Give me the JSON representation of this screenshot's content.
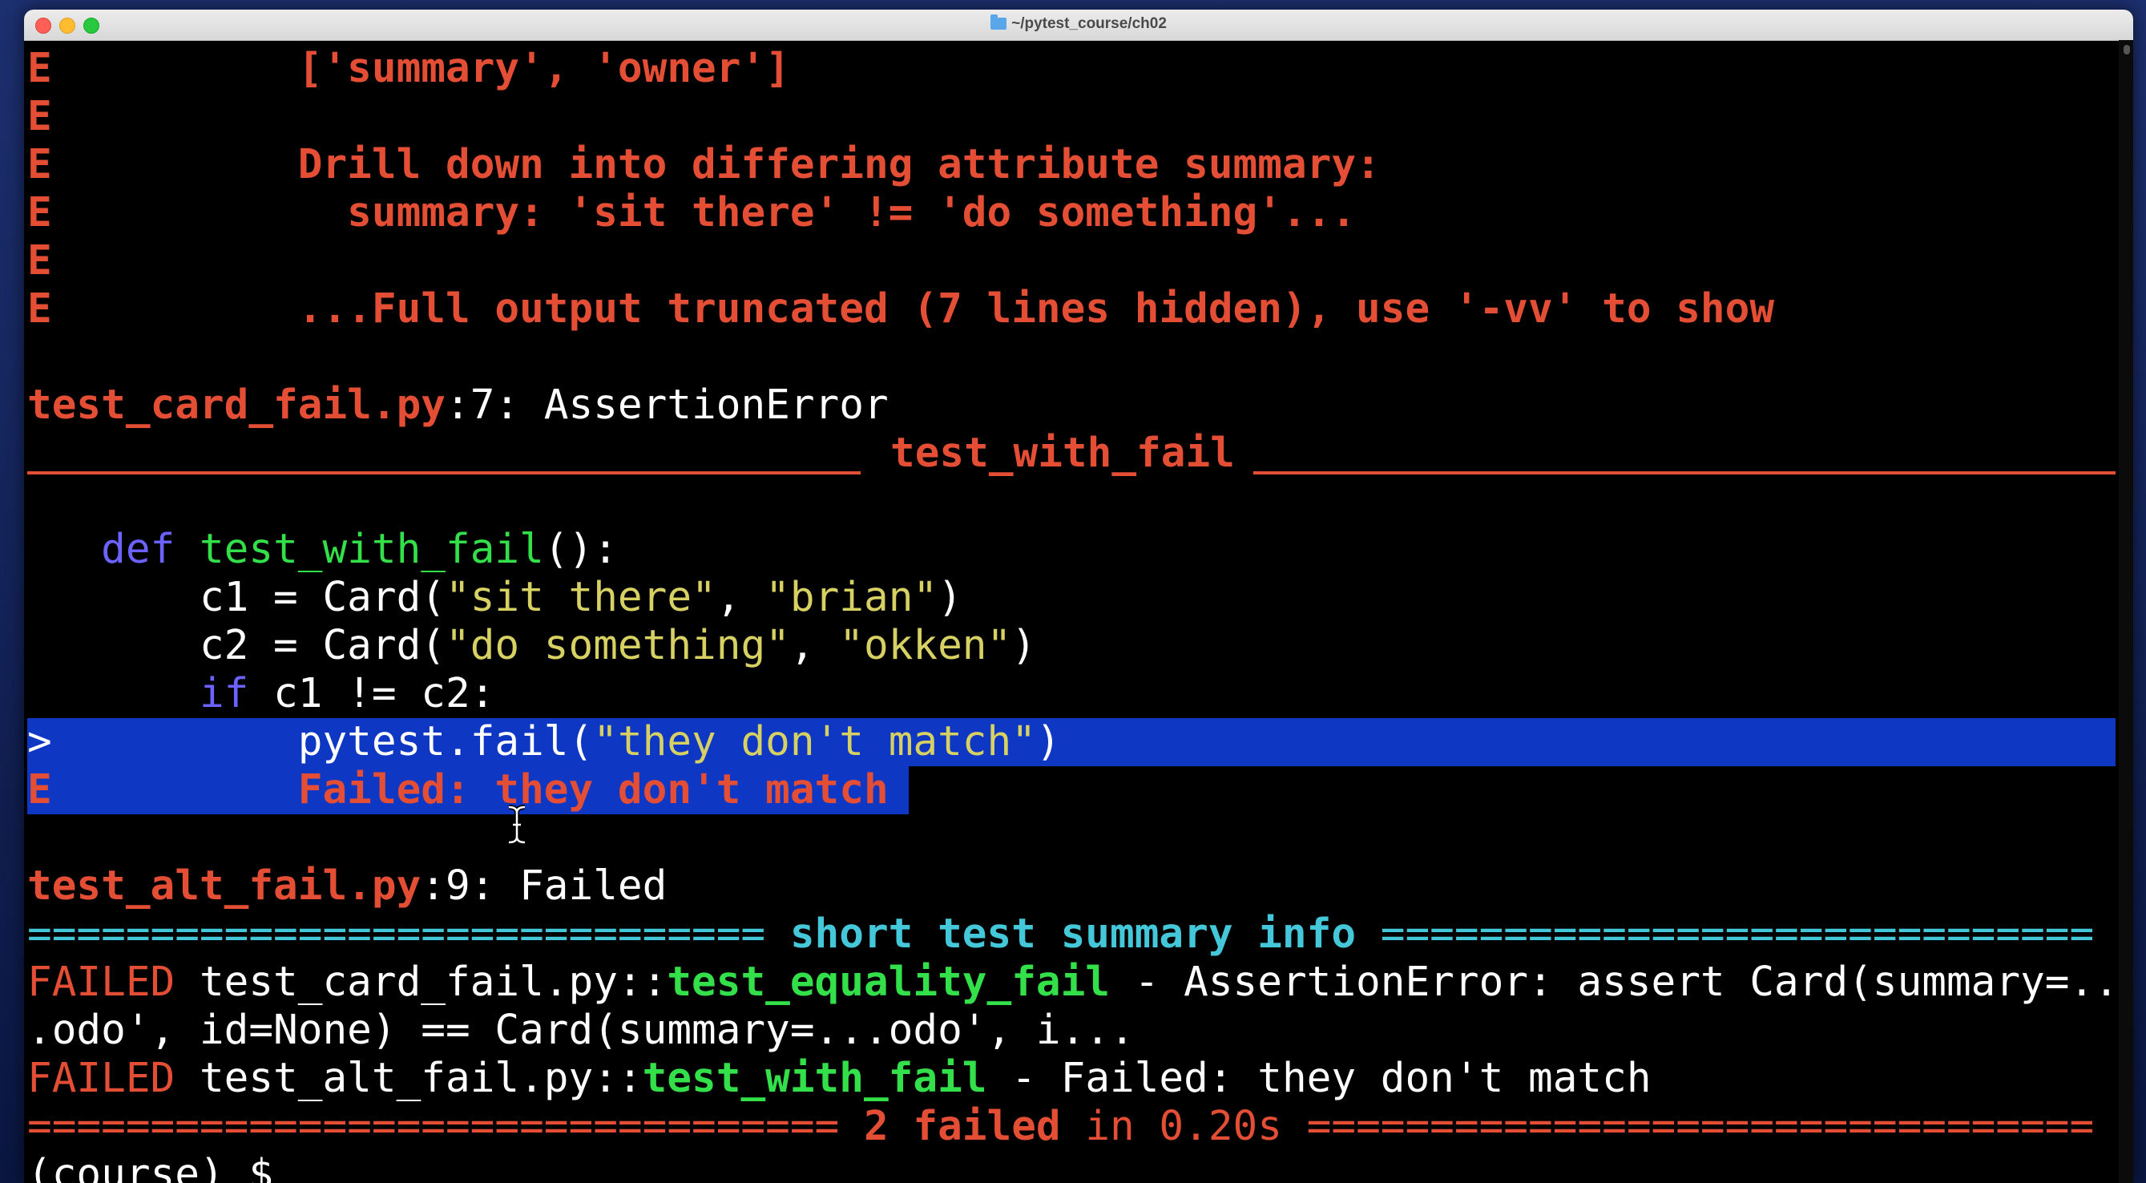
{
  "window": {
    "title": "~/pytest_course/ch02"
  },
  "colors": {
    "error_red": "#e34e35",
    "selection_blue": "#0e37c4",
    "summary_cyan": "#44c7d8",
    "test_green": "#33e04a",
    "string_yellow": "#d7d062",
    "keyword_purple": "#6b62ff"
  },
  "terminal": {
    "l1": {
      "m": "E",
      "t": "          ['summary', 'owner']"
    },
    "l2": {
      "m": "E"
    },
    "l3": {
      "m": "E",
      "t": "          Drill down into differing attribute summary:"
    },
    "l4": {
      "m": "E",
      "t": "            summary: 'sit there' != 'do something'..."
    },
    "l5": {
      "m": "E"
    },
    "l6": {
      "m": "E",
      "t": "          ...Full output truncated (7 lines hidden), use '-vv' to show"
    },
    "l8": {
      "file": "test_card_fail.py",
      "rest": ":7: AssertionError"
    },
    "l9": {
      "header": "test_with_fail"
    },
    "l11": {
      "kw": "def",
      "fn": "test_with_fail",
      "rest": "():"
    },
    "l12": {
      "a": "c1 = Card(",
      "s1": "\"sit there\"",
      "b": ", ",
      "s2": "\"brian\"",
      "c": ")"
    },
    "l13": {
      "a": "c2 = Card(",
      "s1": "\"do something\"",
      "b": ", ",
      "s2": "\"okken\"",
      "c": ")"
    },
    "l14": {
      "kw": "if",
      "rest": " c1 != c2:"
    },
    "l15": {
      "m": ">",
      "a": "pytest.fail(",
      "s": "\"they don't match\"",
      "c": ")"
    },
    "l16": {
      "m": "E",
      "t": "Failed: they don't match"
    },
    "l18": {
      "file": "test_alt_fail.py",
      "rest": ":9: Failed"
    },
    "l19": {
      "left": "============================== ",
      "title": "short test summary info",
      "right": " ============================="
    },
    "l20": {
      "status": "FAILED",
      "path": " test_card_fail.py::",
      "test": "test_equality_fail",
      "msg": " - AssertionError: assert Card(summary=.."
    },
    "l21": {
      "t": ".odo', id=None) == Card(summary=...odo', i..."
    },
    "l22": {
      "status": "FAILED",
      "path": " test_alt_fail.py::",
      "test": "test_with_fail",
      "msg": " - Failed: they don't match"
    },
    "l23": {
      "left": "================================= ",
      "count": "2 failed",
      "in": " in 0.20s",
      "right": " ================================"
    },
    "l24": {
      "prompt": "(course) $ "
    }
  }
}
